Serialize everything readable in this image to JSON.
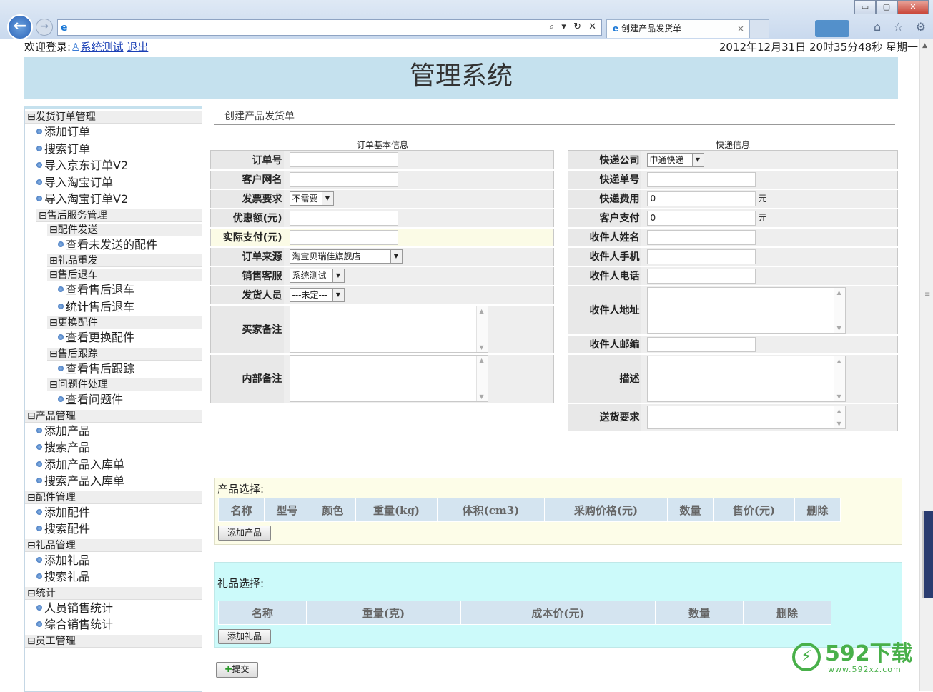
{
  "browser": {
    "tab_title": "创建产品发货单",
    "window_buttons": [
      "▭",
      "▢",
      "✕"
    ],
    "addr_tools": "⌕ ▾ ↻ ✕",
    "right_tools": "⌂ ☆ ⚙"
  },
  "header": {
    "welcome": "欢迎登录:",
    "user": "系统测试",
    "logout": "退出",
    "datetime": "2012年12月31日 20时35分48秒 星期一",
    "title": "管理系统"
  },
  "sidebar": [
    {
      "type": "h",
      "label": "⊟发货订单管理",
      "indent": 0
    },
    {
      "type": "i",
      "label": "添加订单",
      "indent": 16
    },
    {
      "type": "i",
      "label": "搜索订单",
      "indent": 16
    },
    {
      "type": "i",
      "label": "导入京东订单V2",
      "indent": 16
    },
    {
      "type": "i",
      "label": "导入淘宝订单",
      "indent": 16
    },
    {
      "type": "i",
      "label": "导入淘宝订单V2",
      "indent": 16
    },
    {
      "type": "h",
      "label": "⊟售后服务管理",
      "indent": 16
    },
    {
      "type": "h",
      "label": "⊟配件发送",
      "indent": 31
    },
    {
      "type": "i",
      "label": "查看未发送的配件",
      "indent": 46
    },
    {
      "type": "h",
      "label": "⊞礼品重发",
      "indent": 31
    },
    {
      "type": "h",
      "label": "⊟售后退车",
      "indent": 31
    },
    {
      "type": "i",
      "label": "查看售后退车",
      "indent": 46
    },
    {
      "type": "i",
      "label": "统计售后退车",
      "indent": 46
    },
    {
      "type": "h",
      "label": "⊟更换配件",
      "indent": 31
    },
    {
      "type": "i",
      "label": "查看更换配件",
      "indent": 46
    },
    {
      "type": "h",
      "label": "⊟售后跟踪",
      "indent": 31
    },
    {
      "type": "i",
      "label": "查看售后跟踪",
      "indent": 46
    },
    {
      "type": "h",
      "label": "⊟问题件处理",
      "indent": 31
    },
    {
      "type": "i",
      "label": "查看问题件",
      "indent": 46
    },
    {
      "type": "h",
      "label": "⊟产品管理",
      "indent": 0
    },
    {
      "type": "i",
      "label": "添加产品",
      "indent": 16
    },
    {
      "type": "i",
      "label": "搜索产品",
      "indent": 16
    },
    {
      "type": "i",
      "label": "添加产品入库单",
      "indent": 16
    },
    {
      "type": "i",
      "label": "搜索产品入库单",
      "indent": 16
    },
    {
      "type": "h",
      "label": "⊟配件管理",
      "indent": 0
    },
    {
      "type": "i",
      "label": "添加配件",
      "indent": 16
    },
    {
      "type": "i",
      "label": "搜索配件",
      "indent": 16
    },
    {
      "type": "h",
      "label": "⊟礼品管理",
      "indent": 0
    },
    {
      "type": "i",
      "label": "添加礼品",
      "indent": 16
    },
    {
      "type": "i",
      "label": "搜索礼品",
      "indent": 16
    },
    {
      "type": "h",
      "label": "⊟统计",
      "indent": 0
    },
    {
      "type": "i",
      "label": "人员销售统计",
      "indent": 16
    },
    {
      "type": "i",
      "label": "综合销售统计",
      "indent": 16
    },
    {
      "type": "h",
      "label": "⊟员工管理",
      "indent": 0
    }
  ],
  "main": {
    "crumb": "创建产品发货单",
    "order_title": "订单基本信息",
    "ship_title": "快递信息",
    "order_rows": [
      {
        "label": "订单号",
        "kind": "input",
        "value": ""
      },
      {
        "label": "客户网名",
        "kind": "input",
        "value": ""
      },
      {
        "label": "发票要求",
        "kind": "select",
        "value": "不需要"
      },
      {
        "label": "优惠额(元)",
        "kind": "input",
        "value": ""
      },
      {
        "label": "实际支付(元)",
        "kind": "input",
        "value": "",
        "highlight": true
      },
      {
        "label": "订单来源",
        "kind": "select",
        "value": "淘宝贝瑞佳旗舰店"
      },
      {
        "label": "销售客服",
        "kind": "select",
        "value": "系统测试"
      },
      {
        "label": "发货人员",
        "kind": "select",
        "value": "---未定---"
      },
      {
        "label": "买家备注",
        "kind": "textarea",
        "value": ""
      },
      {
        "label": "内部备注",
        "kind": "textarea",
        "value": ""
      }
    ],
    "ship_rows": [
      {
        "label": "快递公司",
        "kind": "select",
        "value": "申通快递"
      },
      {
        "label": "快递单号",
        "kind": "input",
        "value": ""
      },
      {
        "label": "快递费用",
        "kind": "input",
        "value": "0",
        "unit": "元"
      },
      {
        "label": "客户支付",
        "kind": "input",
        "value": "0",
        "unit": "元"
      },
      {
        "label": "收件人姓名",
        "kind": "input",
        "value": ""
      },
      {
        "label": "收件人手机",
        "kind": "input",
        "value": ""
      },
      {
        "label": "收件人电话",
        "kind": "input",
        "value": ""
      },
      {
        "label": "收件人地址",
        "kind": "textarea",
        "value": ""
      },
      {
        "label": "收件人邮编",
        "kind": "input",
        "value": ""
      },
      {
        "label": "描述",
        "kind": "textarea",
        "value": ""
      },
      {
        "label": "送货要求",
        "kind": "textarea",
        "value": ""
      }
    ],
    "product": {
      "title": "产品选择:",
      "columns": [
        "名称",
        "型号",
        "颜色",
        "重量(kg)",
        "体积(cm3)",
        "采购价格(元)",
        "数量",
        "售价(元)",
        "删除"
      ],
      "add_button": "添加产品"
    },
    "gift": {
      "title": "礼品选择:",
      "columns": [
        "名称",
        "重量(克)",
        "成本价(元)",
        "数量",
        "删除"
      ],
      "add_button": "添加礼品"
    },
    "submit": "提交"
  },
  "watermark": {
    "brand": "592下载",
    "url": "www.592xz.com"
  },
  "colors": {
    "banner": "#c5e1ee",
    "product_bg": "#fdfde8",
    "gift_bg": "#ccfafa",
    "grid_header": "#d4e4f0",
    "link": "#1a3fb5",
    "logo": "#49b04a"
  }
}
